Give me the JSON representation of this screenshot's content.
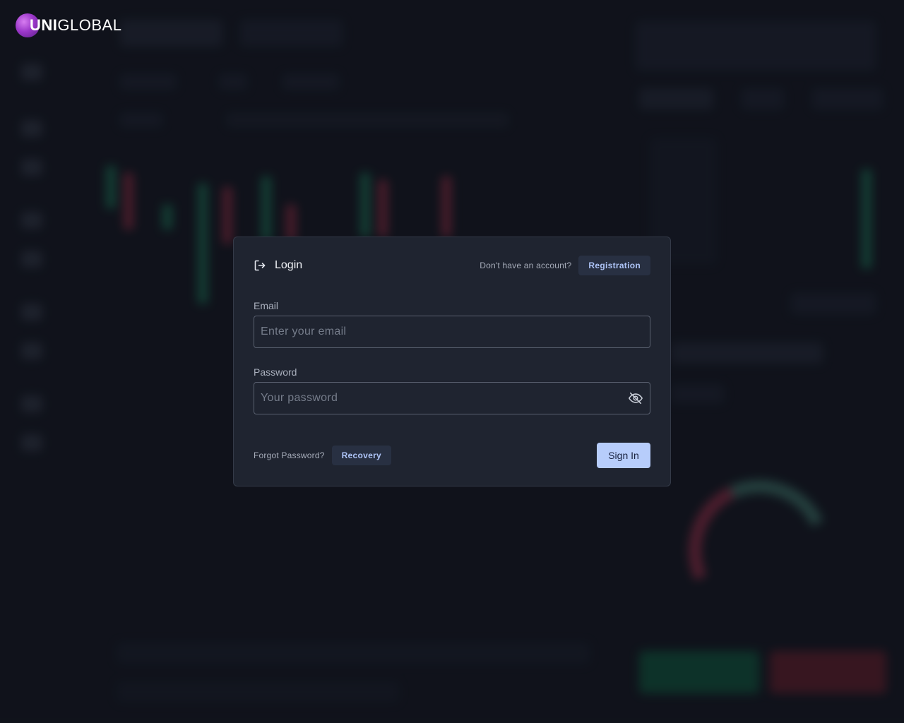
{
  "brand": {
    "logo_bold": "UNI",
    "logo_light": "GLOBAL"
  },
  "login_modal": {
    "title": "Login",
    "no_account_text": "Don't have an account?",
    "registration_label": "Registration",
    "email": {
      "label": "Email",
      "value": "",
      "placeholder": "Enter your email"
    },
    "password": {
      "label": "Password",
      "value": "",
      "placeholder": "Your password",
      "visibility_icon": "eye-off-icon"
    },
    "forgot_text": "Forgot Password?",
    "recovery_label": "Recovery",
    "signin_label": "Sign In"
  },
  "colors": {
    "background": "#141822",
    "modal": "#1f2430",
    "accent": "#b7cdfb",
    "chip_text": "#aec4f7",
    "logo": "#9b37c9"
  }
}
